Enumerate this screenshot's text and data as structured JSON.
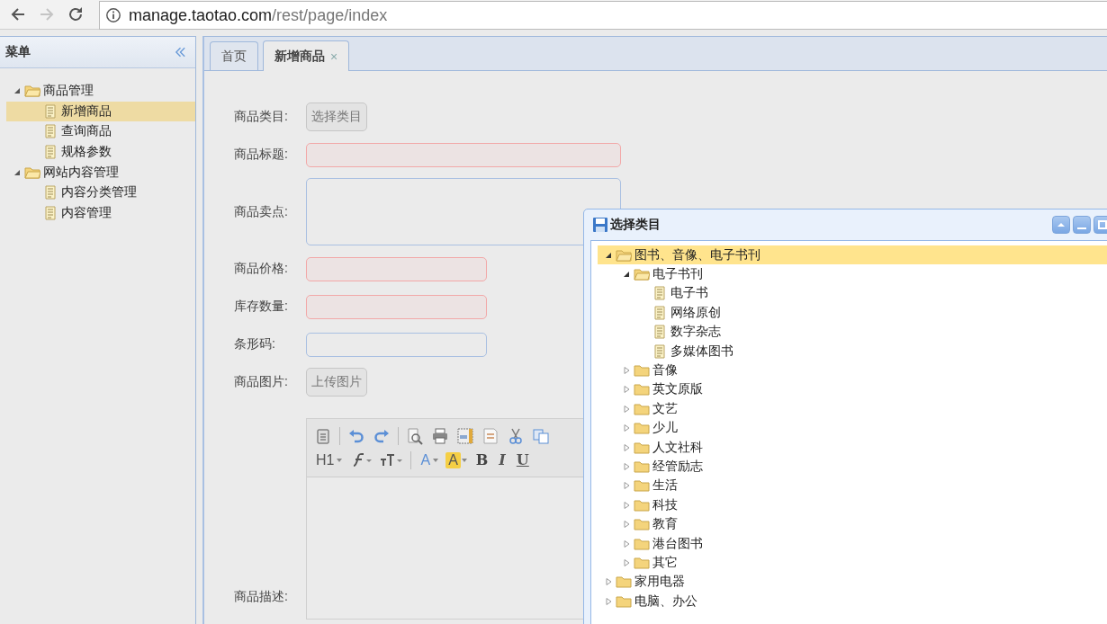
{
  "browser": {
    "address": {
      "host": "manage.taotao.com",
      "path": "/rest/page/index"
    }
  },
  "sidebar": {
    "title": "菜单",
    "tree": [
      {
        "label": "商品管理",
        "kind": "folder",
        "expanded": true,
        "selected": false,
        "children": [
          {
            "label": "新增商品",
            "kind": "file",
            "selected": true
          },
          {
            "label": "查询商品",
            "kind": "file",
            "selected": false
          },
          {
            "label": "规格参数",
            "kind": "file",
            "selected": false
          }
        ]
      },
      {
        "label": "网站内容管理",
        "kind": "folder",
        "expanded": true,
        "selected": false,
        "children": [
          {
            "label": "内容分类管理",
            "kind": "file",
            "selected": false
          },
          {
            "label": "内容管理",
            "kind": "file",
            "selected": false
          }
        ]
      }
    ]
  },
  "tabs": [
    {
      "label": "首页",
      "selected": false
    },
    {
      "label": "新增商品",
      "selected": true,
      "close": "×"
    }
  ],
  "form": [
    {
      "label": "商品类目:",
      "kind": "button",
      "button": "选择类目"
    },
    {
      "label": "商品标题:",
      "kind": "wide_input",
      "invalid": true
    },
    {
      "label": "商品卖点:",
      "kind": "textarea",
      "invalid": false
    },
    {
      "label": "商品价格:",
      "kind": "short_input",
      "invalid": true
    },
    {
      "label": "库存数量:",
      "kind": "short_input",
      "invalid": true
    },
    {
      "label": "条形码:",
      "kind": "short_input",
      "invalid": false
    },
    {
      "label": "商品图片:",
      "kind": "button",
      "button": "上传图片"
    },
    {
      "label": "商品描述:",
      "kind": "editor"
    }
  ],
  "editor": {
    "format_buttons": [
      "H1",
      "A",
      "A",
      "B",
      "I",
      "U"
    ]
  },
  "dialog": {
    "title": "选择类目",
    "tree": [
      {
        "label": "图书、音像、电子书刊",
        "kind": "folder",
        "expanded": true,
        "selected": true,
        "children": [
          {
            "label": "电子书刊",
            "kind": "folder",
            "expanded": true,
            "selected": false,
            "children": [
              {
                "label": "电子书",
                "kind": "file",
                "selected": false
              },
              {
                "label": "网络原创",
                "kind": "file",
                "selected": false
              },
              {
                "label": "数字杂志",
                "kind": "file",
                "selected": false
              },
              {
                "label": "多媒体图书",
                "kind": "file",
                "selected": false
              }
            ]
          },
          {
            "label": "音像",
            "kind": "folder",
            "expanded": false,
            "selected": false
          },
          {
            "label": "英文原版",
            "kind": "folder",
            "expanded": false,
            "selected": false
          },
          {
            "label": "文艺",
            "kind": "folder",
            "expanded": false,
            "selected": false
          },
          {
            "label": "少儿",
            "kind": "folder",
            "expanded": false,
            "selected": false
          },
          {
            "label": "人文社科",
            "kind": "folder",
            "expanded": false,
            "selected": false
          },
          {
            "label": "经管励志",
            "kind": "folder",
            "expanded": false,
            "selected": false
          },
          {
            "label": "生活",
            "kind": "folder",
            "expanded": false,
            "selected": false
          },
          {
            "label": "科技",
            "kind": "folder",
            "expanded": false,
            "selected": false
          },
          {
            "label": "教育",
            "kind": "folder",
            "expanded": false,
            "selected": false
          },
          {
            "label": "港台图书",
            "kind": "folder",
            "expanded": false,
            "selected": false
          },
          {
            "label": "其它",
            "kind": "folder",
            "expanded": false,
            "selected": false
          }
        ]
      },
      {
        "label": "家用电器",
        "kind": "folder",
        "expanded": false,
        "selected": false
      },
      {
        "label": "电脑、办公",
        "kind": "folder",
        "expanded": false,
        "selected": false
      }
    ]
  }
}
